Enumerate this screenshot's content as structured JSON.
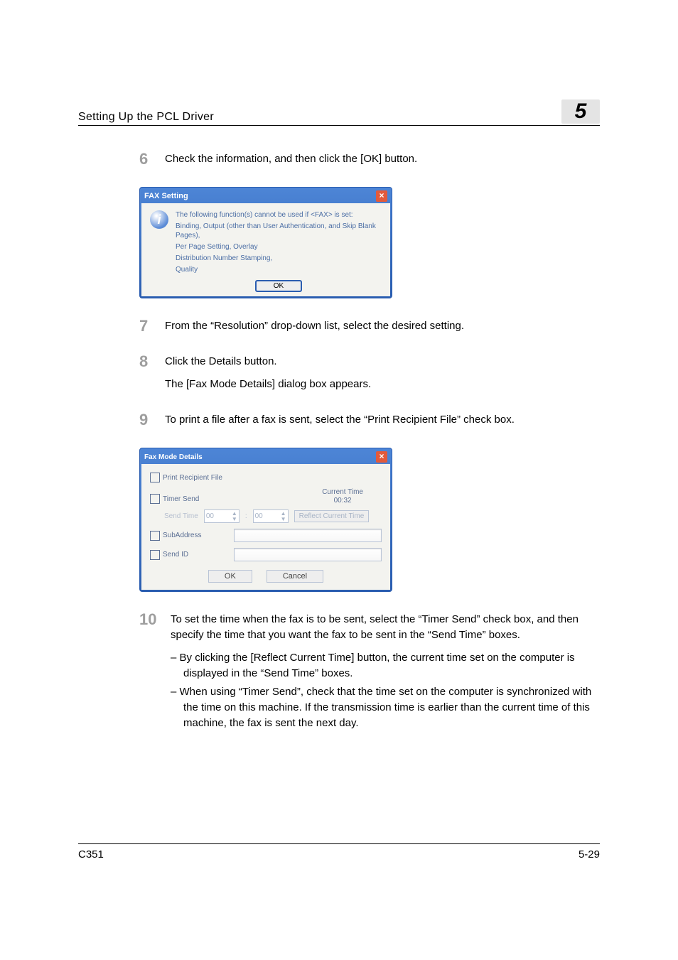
{
  "header": {
    "running_title": "Setting Up the PCL Driver",
    "chapter_number": "5"
  },
  "steps": {
    "s6": {
      "num": "6",
      "text": "Check the information, and then click the [OK] button."
    },
    "s7": {
      "num": "7",
      "text": "From the “Resolution” drop-down list, select the desired setting."
    },
    "s8": {
      "num": "8",
      "text": "Click the Details button.",
      "text2": "The [Fax Mode Details] dialog box appears."
    },
    "s9": {
      "num": "9",
      "text": "To print a file after a fax is sent, select the “Print Recipient File” check box."
    },
    "s10": {
      "num": "10",
      "text": "To set the time when the fax is to be sent, select the “Timer Send” check box, and then specify the time that you want the fax to be sent in the “Send Time” boxes.",
      "bullets": {
        "b1": "By clicking the [Reflect Current Time] button, the current time set on the computer is displayed in the “Send Time” boxes.",
        "b2": "When using “Timer Send”, check that the time set on the computer is synchronized with the time on this machine. If the transmission time is earlier than the current time of this machine, the fax is sent the next day."
      }
    }
  },
  "dlg1": {
    "title": "FAX Setting",
    "info_icon": "i",
    "close": "×",
    "line1": "The following function(s) cannot be used if <FAX> is set:",
    "line2": "Binding, Output (other than User Authentication, and Skip Blank Pages),",
    "line3": "Per Page Setting, Overlay",
    "line4": "Distribution Number Stamping,",
    "line5": "Quality",
    "ok": "OK"
  },
  "dlg2": {
    "title": "Fax Mode Details",
    "close": "×",
    "print_recipient": "Print Recipient File",
    "current_time_label": "Current Time",
    "current_time_value": "00:32",
    "timer_send": "Timer Send",
    "send_time": "Send Time",
    "spin1": "00",
    "spin2": "00",
    "reflect": "Reflect Current Time",
    "subaddress": "SubAddress",
    "send_id": "Send ID",
    "ok": "OK",
    "cancel": "Cancel"
  },
  "footer": {
    "left": "C351",
    "right": "5-29"
  }
}
